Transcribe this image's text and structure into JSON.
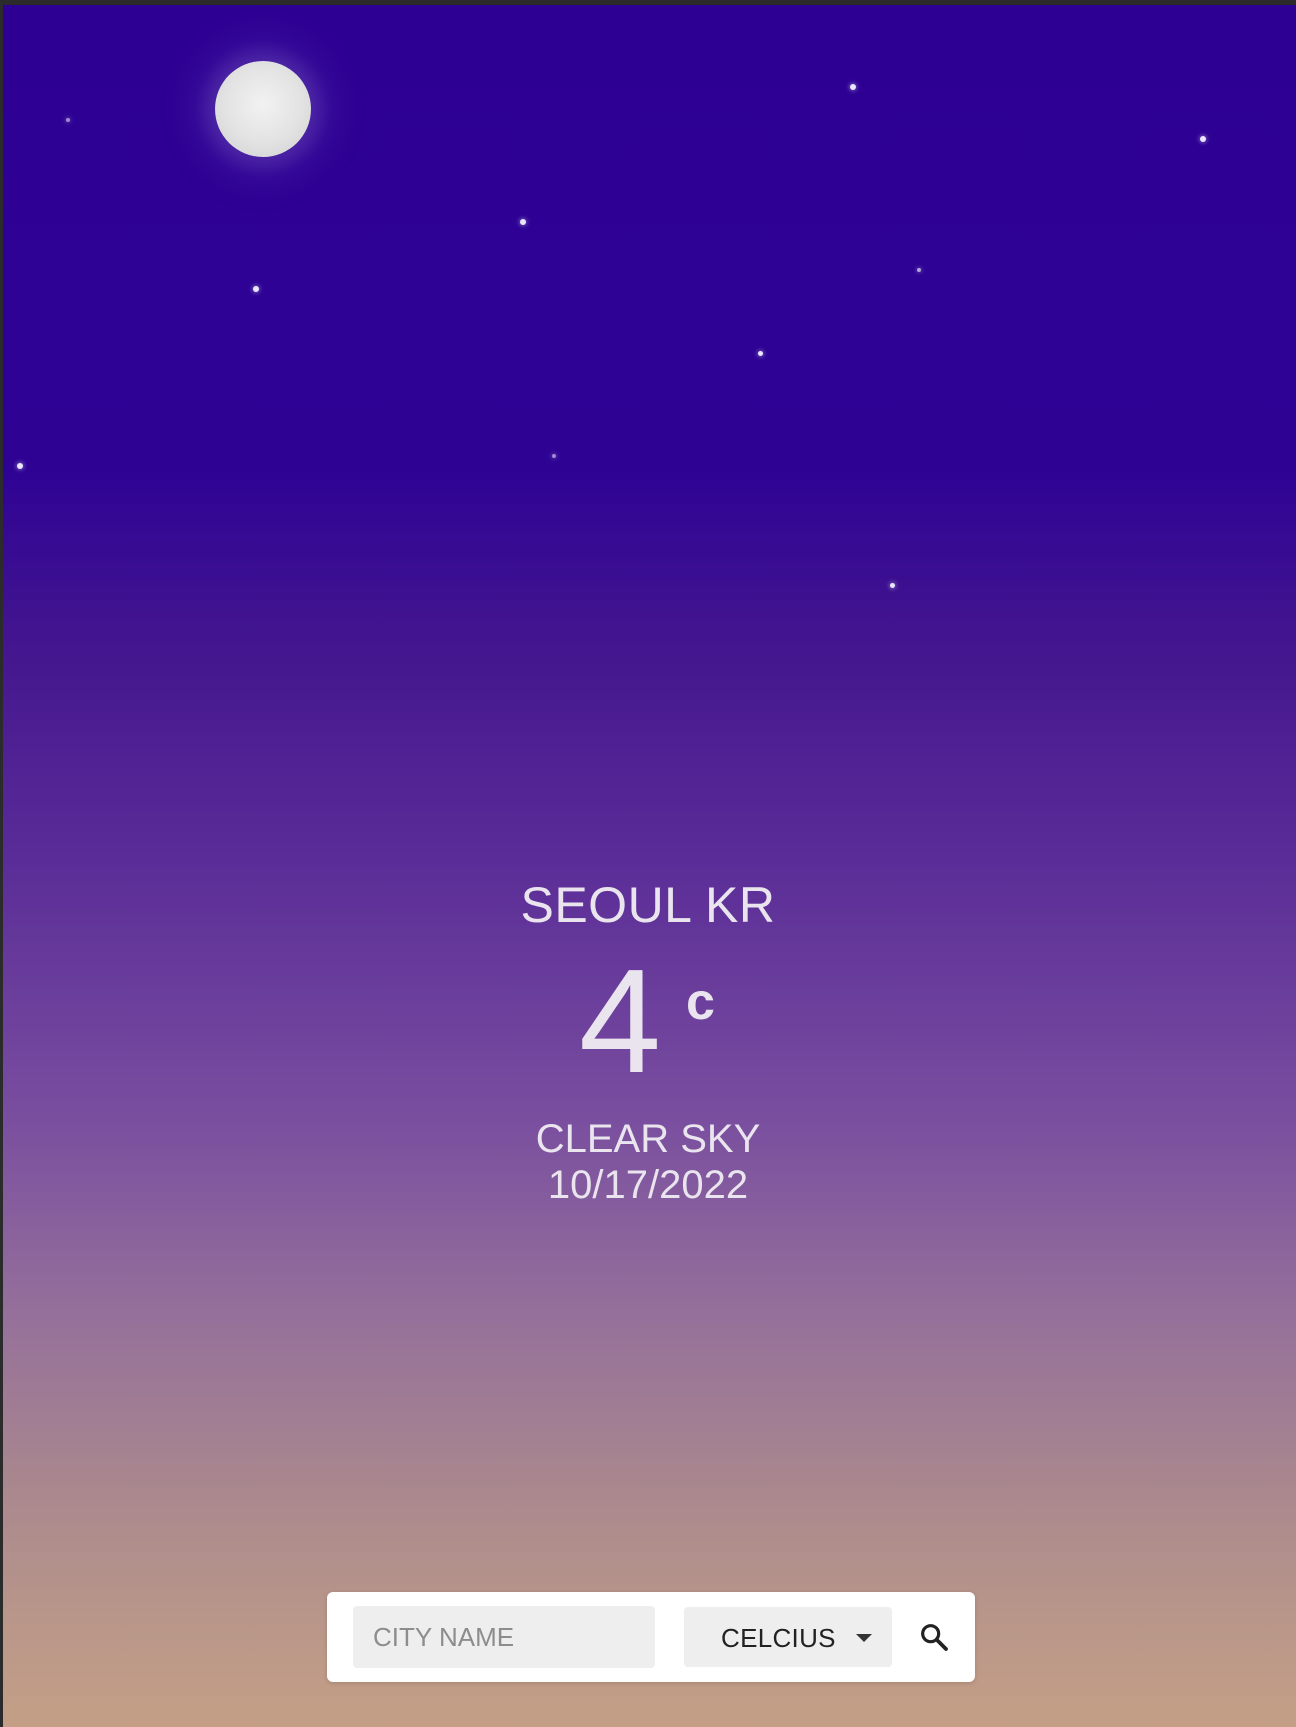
{
  "location": {
    "city": "SEOUL KR"
  },
  "current": {
    "temperature": "4",
    "unit_symbol": "c",
    "condition": "CLEAR SKY",
    "date": "10/17/2022"
  },
  "search": {
    "placeholder": "CITY NAME",
    "value": "",
    "unit_selected": "CELCIUS",
    "icons": {
      "dropdown": "caret-down-icon",
      "submit": "search-icon"
    }
  },
  "theme": {
    "sky_top": "#2d0093",
    "sky_bottom": "#c49f86",
    "text_color": "#e9e4ee"
  }
}
